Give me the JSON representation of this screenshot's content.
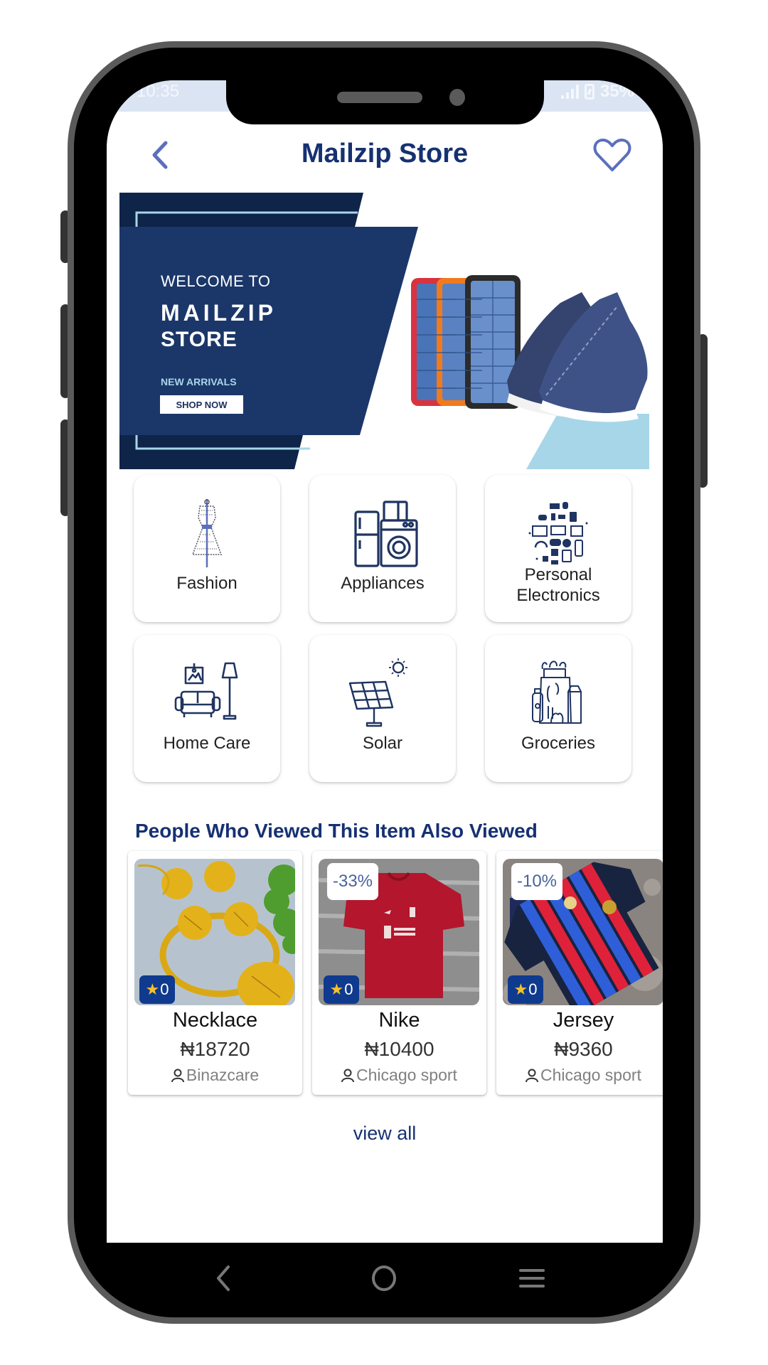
{
  "status_bar": {
    "time": "10:35",
    "battery": "35%",
    "icons": [
      "signal-icon",
      "battery-charging-icon"
    ]
  },
  "header": {
    "title": "Mailzip Store",
    "back_icon": "chevron-left-icon",
    "favorite_icon": "heart-outline-icon"
  },
  "banner": {
    "welcome": "WELCOME TO",
    "brand_line1": "MAILZIP",
    "brand_line2": "STORE",
    "subtitle": "NEW ARRIVALS",
    "cta": "SHOP NOW",
    "images": [
      "solar-power-banks",
      "denim-sneakers"
    ]
  },
  "categories": [
    {
      "label": "Fashion",
      "icon": "dress-mannequin-icon"
    },
    {
      "label": "Appliances",
      "icon": "fridge-washer-icon"
    },
    {
      "label": "Personal Electronics",
      "icon": "electronics-collage-icon"
    },
    {
      "label": "Home Care",
      "icon": "sofa-lamp-icon"
    },
    {
      "label": "Solar",
      "icon": "solar-panel-icon"
    },
    {
      "label": "Groceries",
      "icon": "grocery-bag-icon"
    }
  ],
  "section": {
    "title": "People Who Viewed This Item Also Viewed",
    "view_all": "view all"
  },
  "products": [
    {
      "name": "Necklace",
      "price": "₦18720",
      "seller": "Binazcare",
      "rating": "0",
      "discount": null,
      "image": "gold-necklace-set"
    },
    {
      "name": "Nike",
      "price": "₦10400",
      "seller": "Chicago sport",
      "rating": "0",
      "discount": "-33%",
      "image": "red-liverpool-jersey"
    },
    {
      "name": "Jersey",
      "price": "₦9360",
      "seller": "Chicago sport",
      "rating": "0",
      "discount": "-10%",
      "image": "barcelona-jersey"
    }
  ],
  "nav": {
    "back_icon": "nav-back-icon",
    "home_icon": "nav-home-icon",
    "menu_icon": "nav-menu-icon"
  },
  "colors": {
    "brand_navy": "#163172",
    "banner_navy": "#1b3769",
    "banner_dark": "#0f2449",
    "banner_light_blue": "#a7d6e8",
    "rating_badge": "#0f3a8e",
    "star": "#f6c12f",
    "status_bar": "#dbe4f3",
    "icon_accent": "#5b6fbd"
  }
}
